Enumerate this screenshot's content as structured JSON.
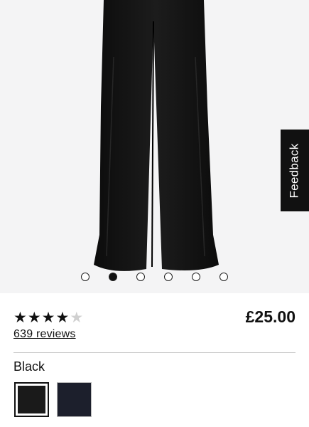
{
  "gallery": {
    "image_alt": "Black wide leg trousers",
    "slides": [
      {
        "active": false
      },
      {
        "active": true
      },
      {
        "active": false
      },
      {
        "active": false
      },
      {
        "active": false
      },
      {
        "active": false
      }
    ]
  },
  "feedback": {
    "label": "Feedback"
  },
  "product": {
    "rating": 4,
    "rating_max": 5,
    "reviews_label": "639 reviews",
    "price": "£25.00"
  },
  "colour": {
    "selected_label": "Black",
    "swatches": [
      {
        "name": "Black",
        "color": "#1a1a1a",
        "selected": true
      },
      {
        "name": "Navy",
        "color": "#1c1f2c",
        "selected": false
      }
    ]
  }
}
